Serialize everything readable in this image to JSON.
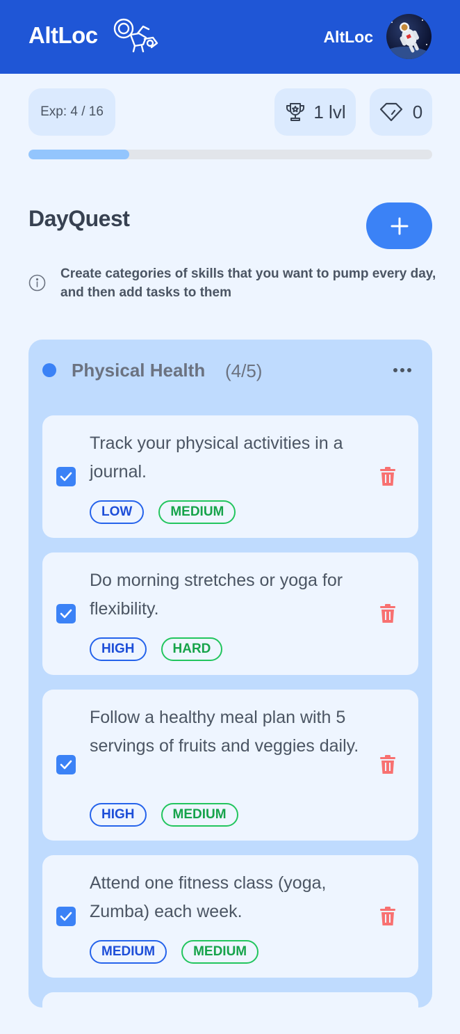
{
  "header": {
    "brand": "AltLoc",
    "user_name": "AltLoc"
  },
  "stats": {
    "exp_label": "Exp: 4 / 16",
    "exp_progress": 0.25,
    "level_label": "1 lvl",
    "gems": "0"
  },
  "page": {
    "title": "DayQuest",
    "info": "Create categories of skills that you want to pump every day, and then add tasks to them"
  },
  "colors": {
    "header_bg": "#1f56d6",
    "accent": "#3b82f6",
    "category_bg": "#bfdbfe",
    "delete": "#f87171"
  },
  "category": {
    "name": "Physical Health",
    "count": "(4/5)",
    "tasks": [
      {
        "text": "Track your physical activities in a journal.",
        "done": true,
        "tags": [
          "LOW",
          "MEDIUM"
        ]
      },
      {
        "text": "Do morning stretches or yoga for flexibility.",
        "done": true,
        "tags": [
          "HIGH",
          "HARD"
        ]
      },
      {
        "text": "Follow a healthy meal plan with 5 servings of fruits and veggies daily.",
        "done": true,
        "tags": [
          "HIGH",
          "MEDIUM"
        ]
      },
      {
        "text": "Attend one fitness class (yoga, Zumba) each week.",
        "done": true,
        "tags": [
          "MEDIUM",
          "MEDIUM"
        ]
      }
    ]
  },
  "icons": {
    "logo": "astronaut-icon",
    "trophy": "trophy-icon",
    "gem": "gem-icon",
    "add": "plus-icon",
    "info": "info-icon",
    "menu": "more-dots-icon",
    "check": "check-icon",
    "delete": "trash-icon"
  }
}
